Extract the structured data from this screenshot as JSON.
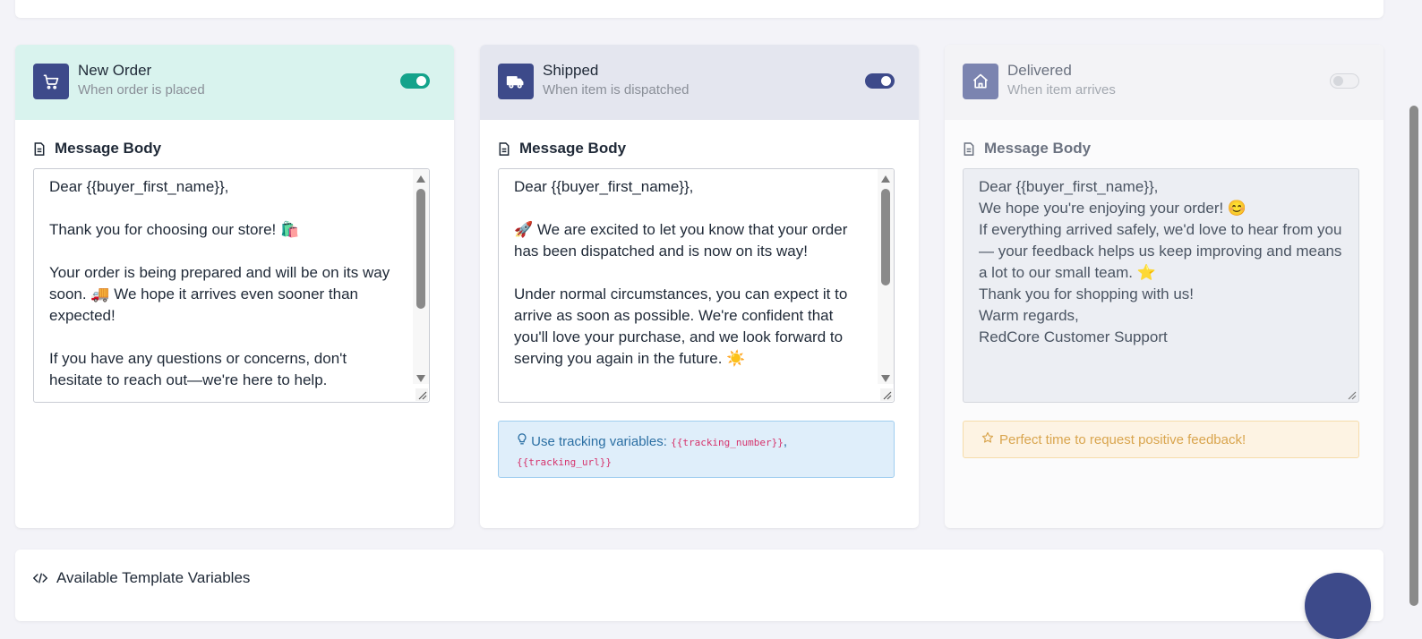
{
  "cards": [
    {
      "title": "New Order",
      "subtitle": "When order is placed",
      "toggle_on": true,
      "icon": "shopping-cart-icon",
      "section_label": "Message Body",
      "message": "Dear {{buyer_first_name}},\n\nThank you for choosing our store! 🛍️\n\nYour order is being prepared and will be on its way soon. 🚚 We hope it arrives even sooner than expected!\n\nIf you have any questions or concerns, don't hesitate to reach out—we're here to help."
    },
    {
      "title": "Shipped",
      "subtitle": "When item is dispatched",
      "toggle_on": true,
      "icon": "truck-icon",
      "section_label": "Message Body",
      "message": "Dear {{buyer_first_name}},\n\n🚀 We are excited to let you know that your order has been dispatched and is now on its way!\n\nUnder normal circumstances, you can expect it to arrive as soon as possible. We're confident that you'll love your purchase, and we look forward to serving you again in the future. ☀️",
      "tip": {
        "text": "Use tracking variables:",
        "var1": "{{tracking_number}}",
        "separator": ",",
        "var2": "{{tracking_url}}"
      }
    },
    {
      "title": "Delivered",
      "subtitle": "When item arrives",
      "toggle_on": false,
      "icon": "home-icon",
      "section_label": "Message Body",
      "message": "Dear {{buyer_first_name}},\nWe hope you're enjoying your order! 😊\nIf everything arrived safely, we'd love to hear from you — your feedback helps us keep improving and means a lot to our small team. ⭐\nThank you for shopping with us!\nWarm regards,\nRedCore Customer Support",
      "tip": {
        "text": "Perfect time to request positive feedback!"
      }
    }
  ],
  "bottom": {
    "label": "Available Template Variables"
  },
  "colors": {
    "accent_teal": "#14a38b",
    "accent_navy": "#3d4a8a",
    "info_text": "#2b6fa3",
    "warn_text": "#d9a54e",
    "code_pink": "#d6336c"
  }
}
